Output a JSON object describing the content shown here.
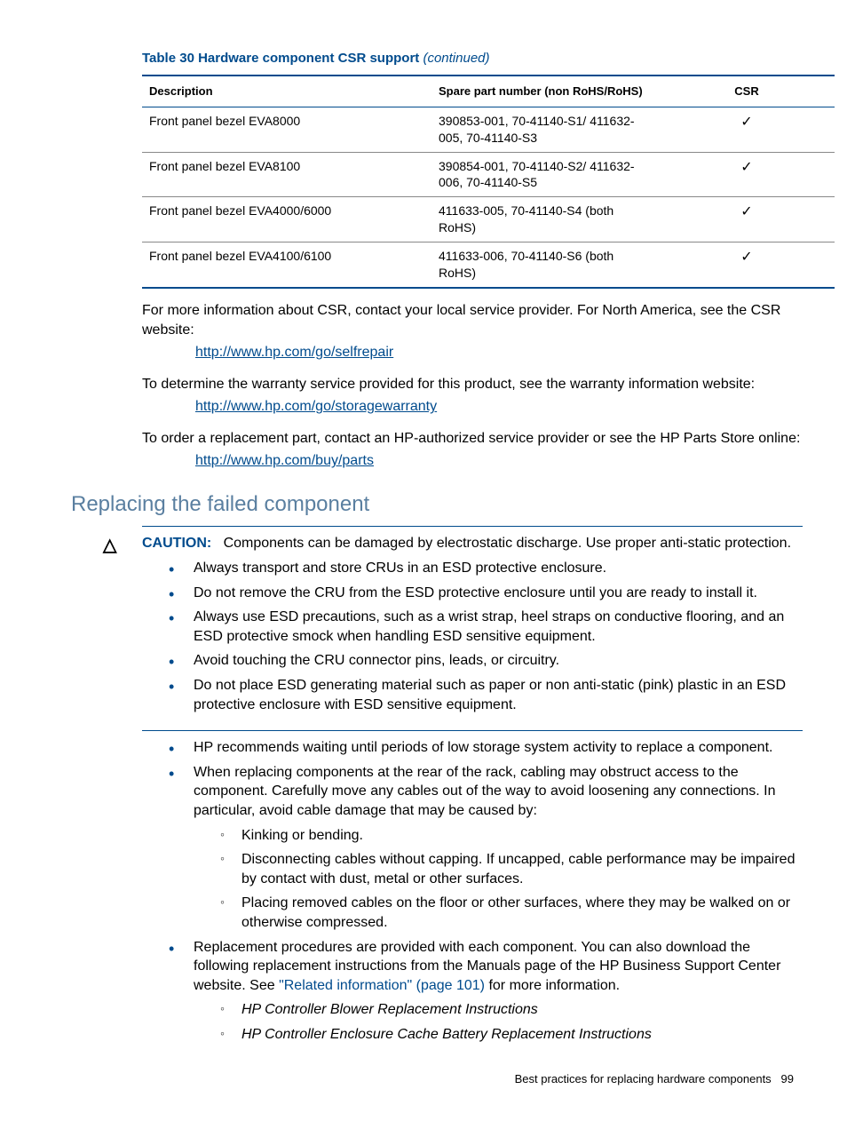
{
  "table": {
    "caption_main": "Table 30 Hardware component CSR support",
    "caption_cont": "(continued)",
    "headers": {
      "description": "Description",
      "spare": "Spare part number (non RoHS/RoHS)",
      "csr": "CSR"
    },
    "rows": [
      {
        "description": "Front panel bezel EVA8000",
        "spare": "390853-001, 70-41140-S1/ 411632-005, 70-41140-S3",
        "csr": "✓"
      },
      {
        "description": "Front panel bezel EVA8100",
        "spare": "390854-001, 70-41140-S2/ 411632-006, 70-41140-S5",
        "csr": "✓"
      },
      {
        "description": "Front panel bezel EVA4000/6000",
        "spare": "411633-005, 70-41140-S4 (both RoHS)",
        "csr": "✓"
      },
      {
        "description": "Front panel bezel EVA4100/6100",
        "spare": "411633-006, 70-41140-S6 (both RoHS)",
        "csr": "✓"
      }
    ]
  },
  "paragraphs": {
    "p1": "For more information about CSR, contact your local service provider. For North America, see the CSR website:",
    "link1": "http://www.hp.com/go/selfrepair",
    "p2": "To determine the warranty service provided for this product, see the warranty information website:",
    "link2": "http://www.hp.com/go/storagewarranty",
    "p3": "To order a replacement part, contact an HP-authorized service provider or see the HP Parts Store online:",
    "link3": "http://www.hp.com/buy/parts"
  },
  "section_heading": "Replacing the failed component",
  "caution": {
    "label": "CAUTION:",
    "text": "Components can be damaged by electrostatic discharge. Use proper anti-static protection.",
    "bullets": [
      "Always transport and store CRUs in an ESD protective enclosure.",
      "Do not remove the CRU from the ESD protective enclosure until you are ready to install it.",
      "Always use ESD precautions, such as a wrist strap, heel straps on conductive flooring, and an ESD protective smock when handling ESD sensitive equipment.",
      "Avoid touching the CRU connector pins, leads, or circuitry.",
      "Do not place ESD generating material such as paper or non anti-static (pink) plastic in an ESD protective enclosure with ESD sensitive equipment."
    ]
  },
  "main_bullets": {
    "b1": "HP recommends waiting until periods of low storage system activity to replace a component.",
    "b2": "When replacing components at the rear of the rack, cabling may obstruct access to the component. Carefully move any cables out of the way to avoid loosening any connections. In particular, avoid cable damage that may be caused by:",
    "b2_sub": [
      "Kinking or bending.",
      "Disconnecting cables without capping. If uncapped, cable performance may be impaired by contact with dust, metal or other surfaces.",
      "Placing removed cables on the floor or other surfaces, where they may be walked on or otherwise compressed."
    ],
    "b3_pre": "Replacement procedures are provided with each component. You can also download the following replacement instructions from the Manuals page of the HP Business Support Center website. See ",
    "b3_xref": "\"Related information\" (page 101)",
    "b3_post": " for more information.",
    "b3_sub": [
      "HP Controller Blower Replacement Instructions",
      "HP Controller Enclosure Cache Battery Replacement Instructions"
    ]
  },
  "footer": {
    "text": "Best practices for replacing hardware components",
    "page": "99"
  }
}
